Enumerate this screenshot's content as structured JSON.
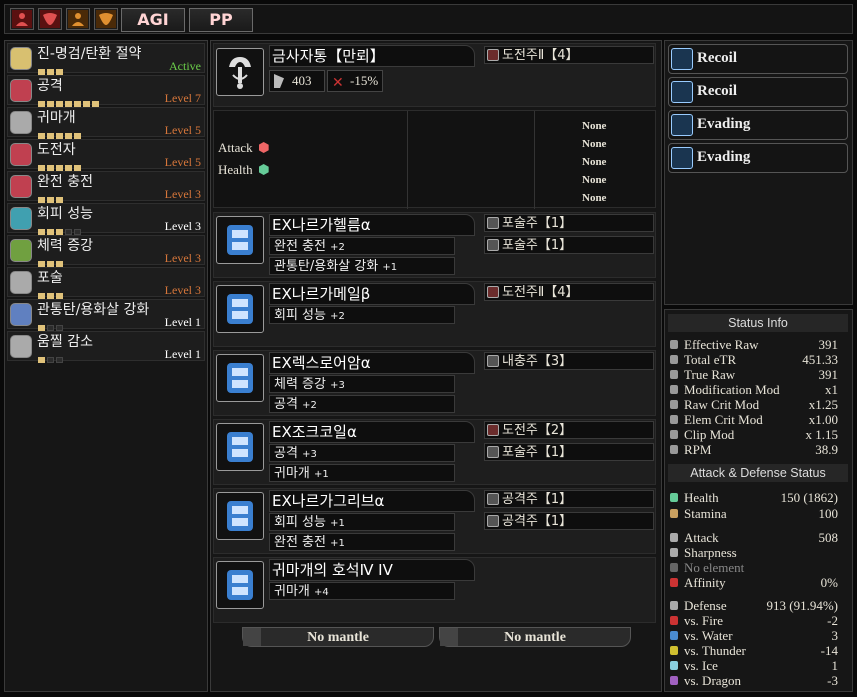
{
  "topbar": {
    "icons": [
      "hunter-red-icon",
      "hunter-red-icon",
      "hunter-orange-icon",
      "hunter-orange-icon"
    ],
    "agi_label": "AGI",
    "pp_label": "PP"
  },
  "skills": [
    {
      "name": "진-명검/탄환 절약",
      "level": "Active",
      "filled": 3,
      "total": 3,
      "icon": "sword-icon",
      "color": "#6ccf4a"
    },
    {
      "name": "공격",
      "level": "Level 7",
      "filled": 7,
      "total": 7,
      "icon": "attack-icon",
      "color": "#d6763a"
    },
    {
      "name": "귀마개",
      "level": "Level 5",
      "filled": 5,
      "total": 5,
      "icon": "earplugs-icon",
      "color": "#d6763a"
    },
    {
      "name": "도전자",
      "level": "Level 5",
      "filled": 5,
      "total": 5,
      "icon": "challenger-icon",
      "color": "#d6763a"
    },
    {
      "name": "완전 충전",
      "level": "Level 3",
      "filled": 3,
      "total": 3,
      "icon": "full-charge-icon",
      "color": "#d6763a"
    },
    {
      "name": "회피 성능",
      "level": "Level 3",
      "filled": 3,
      "total": 5,
      "icon": "evade-icon",
      "color": "#ffffff"
    },
    {
      "name": "체력 증강",
      "level": "Level 3",
      "filled": 3,
      "total": 3,
      "icon": "health-boost-icon",
      "color": "#d6763a"
    },
    {
      "name": "포술",
      "level": "Level 3",
      "filled": 3,
      "total": 3,
      "icon": "artillery-icon",
      "color": "#d6763a"
    },
    {
      "name": "관통탄/용화살 강화",
      "level": "Level 1",
      "filled": 1,
      "total": 3,
      "icon": "pierce-up-icon",
      "color": "#ffffff"
    },
    {
      "name": "움찔 감소",
      "level": "Level 1",
      "filled": 1,
      "total": 3,
      "icon": "flinch-free-icon",
      "color": "#ffffff"
    }
  ],
  "weapon": {
    "name": "금사자통【만뢰】",
    "attack": "403",
    "affinity": "-15%",
    "deco": "도전주Ⅱ【4】",
    "attack_label": "Attack",
    "health_label": "Health",
    "none": [
      "None",
      "None",
      "None",
      "None",
      "None"
    ]
  },
  "armor": [
    {
      "name": "EX나르가헬름α",
      "skills": [
        {
          "n": "완전 충전",
          "b": "+2"
        },
        {
          "n": "관통탄/용화살 강화",
          "b": "+1"
        }
      ],
      "decos": [
        "포술주【1】",
        "포술주【1】"
      ]
    },
    {
      "name": "EX나르가메일β",
      "skills": [
        {
          "n": "회피 성능",
          "b": "+2"
        }
      ],
      "decos": [
        "도전주Ⅱ【4】"
      ]
    },
    {
      "name": "EX렉스로어암α",
      "skills": [
        {
          "n": "체력 증강",
          "b": "+3"
        },
        {
          "n": "공격",
          "b": "+2"
        }
      ],
      "decos": [
        "내충주【3】"
      ]
    },
    {
      "name": "EX조크코일α",
      "skills": [
        {
          "n": "공격",
          "b": "+3"
        },
        {
          "n": "귀마개",
          "b": "+1"
        }
      ],
      "decos": [
        "도전주【2】",
        "포술주【1】"
      ]
    },
    {
      "name": "EX나르가그리브α",
      "skills": [
        {
          "n": "회피 성능",
          "b": "+1"
        },
        {
          "n": "완전 충전",
          "b": "+1"
        }
      ],
      "decos": [
        "공격주【1】",
        "공격주【1】"
      ]
    },
    {
      "name": "귀마개의 호석Ⅳ IV",
      "skills": [
        {
          "n": "귀마개",
          "b": "+4"
        }
      ],
      "decos": []
    }
  ],
  "mantles": [
    "No mantle",
    "No mantle"
  ],
  "right_buttons": [
    "Recoil",
    "Recoil",
    "Evading",
    "Evading"
  ],
  "status_info": {
    "title": "Status Info",
    "rows": [
      {
        "l": "Effective Raw",
        "v": "391"
      },
      {
        "l": "Total eTR",
        "v": "451.33"
      },
      {
        "l": "True Raw",
        "v": "391"
      },
      {
        "l": "Modification Mod",
        "v": "x1"
      },
      {
        "l": "Raw Crit Mod",
        "v": "x1.25"
      },
      {
        "l": "Elem Crit Mod",
        "v": "x1.00"
      },
      {
        "l": "Clip Mod",
        "v": "x 1.15"
      },
      {
        "l": "RPM",
        "v": "38.9"
      }
    ]
  },
  "atk_def": {
    "title": "Attack & Defense Status",
    "health": {
      "l": "Health",
      "v": "150 (1862)"
    },
    "stamina": {
      "l": "Stamina",
      "v": "100"
    },
    "attack": {
      "l": "Attack",
      "v": "508"
    },
    "sharpness": {
      "l": "Sharpness",
      "v": ""
    },
    "element": {
      "l": "No element",
      "v": ""
    },
    "affinity": {
      "l": "Affinity",
      "v": "0%"
    },
    "defense": {
      "l": "Defense",
      "v": "913 (91.94%)"
    },
    "res": [
      {
        "l": "vs. Fire",
        "v": "-2"
      },
      {
        "l": "vs. Water",
        "v": "3"
      },
      {
        "l": "vs. Thunder",
        "v": "-14"
      },
      {
        "l": "vs. Ice",
        "v": "1"
      },
      {
        "l": "vs. Dragon",
        "v": "-3"
      }
    ]
  }
}
